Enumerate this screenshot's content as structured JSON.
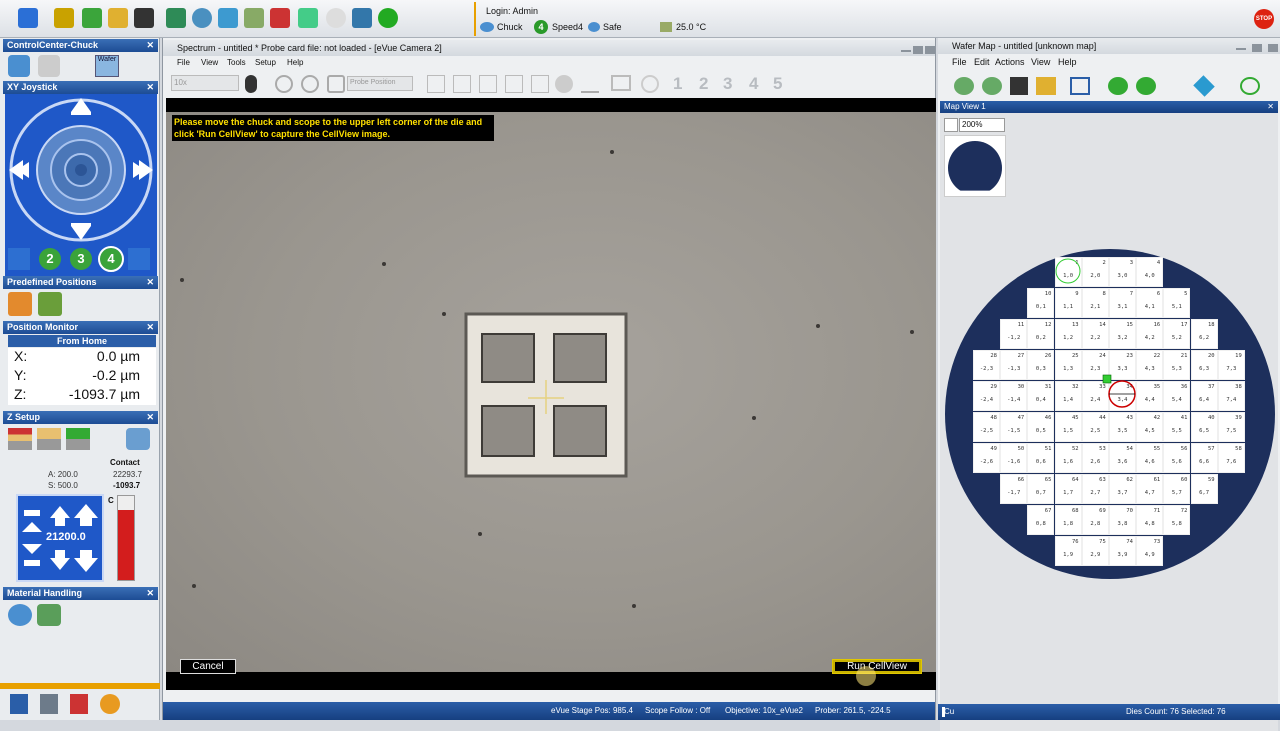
{
  "login": {
    "user": "Login: Admin",
    "chuck": "Chuck",
    "speed": "Speed4",
    "safe": "Safe",
    "temp": "25.0 °C"
  },
  "stop_label": "STOP",
  "left": {
    "title": "ControlCenter-Chuck",
    "wafer_tab": "Wafer",
    "joystick": "XY Joystick",
    "speed_buttons": [
      "2",
      "3",
      "4"
    ],
    "predefined": "Predefined Positions",
    "position_monitor": "Position Monitor",
    "from_home": "From Home",
    "pos": {
      "x_label": "X:",
      "x": "0.0 µm",
      "y_label": "Y:",
      "y": "-0.2 µm",
      "z_label": "Z:",
      "z": "-1093.7 µm"
    },
    "zsetup": "Z Setup",
    "contact_label": "Contact",
    "contact_val1": "22293.7",
    "contact_val2": "-1093.7",
    "a_val": "A: 200.0",
    "s_val": "S: 500.0",
    "z_step": "21200.0",
    "c_label": "C",
    "material": "Material Handling"
  },
  "cam": {
    "title": "Spectrum - untitled *  Probe card file: not loaded - [eVue Camera 2]",
    "menu": [
      "File",
      "View",
      "Tools",
      "Setup",
      "Help"
    ],
    "objective_select": "10x",
    "probe_position": "Probe Position",
    "numbers": [
      "1",
      "2",
      "3",
      "4",
      "5"
    ],
    "message": "Please move the chuck and scope to the upper left corner of the die and click 'Run CellView' to capture the CellView image.",
    "cancel": "Cancel",
    "run": "Run CellView",
    "status": {
      "stage": "eVue Stage Pos: 985.4",
      "follow": "Scope Follow : Off",
      "objective": "Objective: 10x_eVue2",
      "prober": "Prober:     261.5,  -224.5"
    }
  },
  "wafer": {
    "title": "Wafer Map - untitled [unknown map]",
    "menu": [
      "File",
      "Edit",
      "Actions",
      "View",
      "Help"
    ],
    "mapview": "Map View 1",
    "zoom": "200%",
    "status_left": "Cu",
    "status_right": "Dies Count: 76 Selected: 76",
    "dies": [
      {
        "n": "1",
        "c": "1,0"
      },
      {
        "n": "2",
        "c": "2,0"
      },
      {
        "n": "3",
        "c": "3,0"
      },
      {
        "n": "4",
        "c": "4,0"
      },
      {
        "n": "10",
        "c": "0,1"
      },
      {
        "n": "9",
        "c": "1,1"
      },
      {
        "n": "8",
        "c": "2,1"
      },
      {
        "n": "7",
        "c": "3,1"
      },
      {
        "n": "6",
        "c": "4,1"
      },
      {
        "n": "5",
        "c": "5,1"
      },
      {
        "n": "11",
        "c": "-1,2"
      },
      {
        "n": "12",
        "c": "0,2"
      },
      {
        "n": "13",
        "c": "1,2"
      },
      {
        "n": "14",
        "c": "2,2"
      },
      {
        "n": "15",
        "c": "3,2"
      },
      {
        "n": "16",
        "c": "4,2"
      },
      {
        "n": "17",
        "c": "5,2"
      },
      {
        "n": "18",
        "c": "6,2"
      },
      {
        "n": "28",
        "c": "-2,3"
      },
      {
        "n": "27",
        "c": "-1,3"
      },
      {
        "n": "26",
        "c": "0,3"
      },
      {
        "n": "25",
        "c": "1,3"
      },
      {
        "n": "24",
        "c": "2,3"
      },
      {
        "n": "23",
        "c": "3,3"
      },
      {
        "n": "22",
        "c": "4,3"
      },
      {
        "n": "21",
        "c": "5,3"
      },
      {
        "n": "20",
        "c": "6,3"
      },
      {
        "n": "19",
        "c": "7,3"
      },
      {
        "n": "29",
        "c": "-2,4"
      },
      {
        "n": "30",
        "c": "-1,4"
      },
      {
        "n": "31",
        "c": "0,4"
      },
      {
        "n": "32",
        "c": "1,4"
      },
      {
        "n": "33",
        "c": "2,4"
      },
      {
        "n": "34",
        "c": "3,4"
      },
      {
        "n": "35",
        "c": "4,4"
      },
      {
        "n": "36",
        "c": "5,4"
      },
      {
        "n": "37",
        "c": "6,4"
      },
      {
        "n": "38",
        "c": "7,4"
      },
      {
        "n": "48",
        "c": "-2,5"
      },
      {
        "n": "47",
        "c": "-1,5"
      },
      {
        "n": "46",
        "c": "0,5"
      },
      {
        "n": "45",
        "c": "1,5"
      },
      {
        "n": "44",
        "c": "2,5"
      },
      {
        "n": "43",
        "c": "3,5"
      },
      {
        "n": "42",
        "c": "4,5"
      },
      {
        "n": "41",
        "c": "5,5"
      },
      {
        "n": "40",
        "c": "6,5"
      },
      {
        "n": "39",
        "c": "7,5"
      },
      {
        "n": "49",
        "c": "-2,6"
      },
      {
        "n": "50",
        "c": "-1,6"
      },
      {
        "n": "51",
        "c": "0,6"
      },
      {
        "n": "52",
        "c": "1,6"
      },
      {
        "n": "53",
        "c": "2,6"
      },
      {
        "n": "54",
        "c": "3,6"
      },
      {
        "n": "55",
        "c": "4,6"
      },
      {
        "n": "56",
        "c": "5,6"
      },
      {
        "n": "57",
        "c": "6,6"
      },
      {
        "n": "58",
        "c": "7,6"
      },
      {
        "n": "66",
        "c": "-1,7"
      },
      {
        "n": "65",
        "c": "0,7"
      },
      {
        "n": "64",
        "c": "1,7"
      },
      {
        "n": "63",
        "c": "2,7"
      },
      {
        "n": "62",
        "c": "3,7"
      },
      {
        "n": "61",
        "c": "4,7"
      },
      {
        "n": "60",
        "c": "5,7"
      },
      {
        "n": "59",
        "c": "6,7"
      },
      {
        "n": "67",
        "c": "0,8"
      },
      {
        "n": "68",
        "c": "1,8"
      },
      {
        "n": "69",
        "c": "2,8"
      },
      {
        "n": "70",
        "c": "3,8"
      },
      {
        "n": "71",
        "c": "4,8"
      },
      {
        "n": "72",
        "c": "5,8"
      },
      {
        "n": "76",
        "c": "1,9"
      },
      {
        "n": "75",
        "c": "2,9"
      },
      {
        "n": "74",
        "c": "3,9"
      },
      {
        "n": "73",
        "c": "4,9"
      }
    ]
  }
}
